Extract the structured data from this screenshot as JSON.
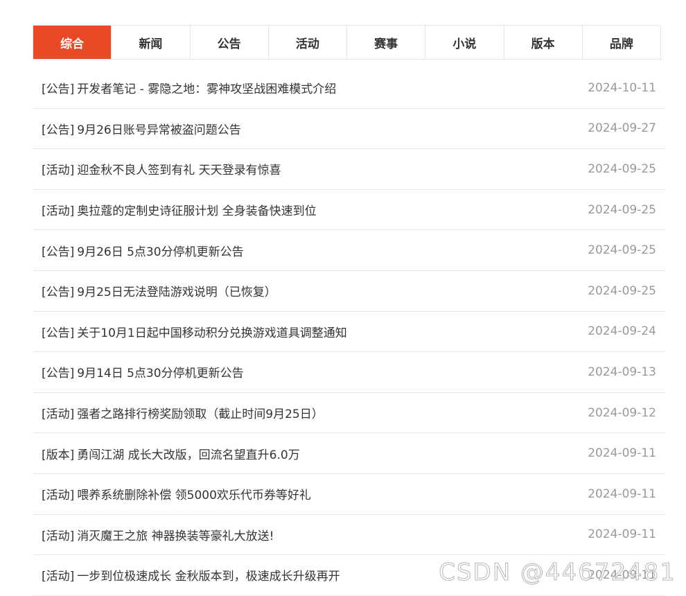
{
  "tabs": [
    {
      "label": "综合",
      "active": true
    },
    {
      "label": "新闻",
      "active": false
    },
    {
      "label": "公告",
      "active": false
    },
    {
      "label": "活动",
      "active": false
    },
    {
      "label": "赛事",
      "active": false
    },
    {
      "label": "小说",
      "active": false
    },
    {
      "label": "版本",
      "active": false
    },
    {
      "label": "品牌",
      "active": false
    }
  ],
  "news": [
    {
      "category": "[公告]",
      "title": "开发者笔记 - 雾隐之地：雾神攻坚战困难模式介绍",
      "date": "2024-10-11"
    },
    {
      "category": "[公告]",
      "title": "9月26日账号异常被盗问题公告",
      "date": "2024-09-27"
    },
    {
      "category": "[活动]",
      "title": "迎金秋不良人签到有礼 天天登录有惊喜",
      "date": "2024-09-25"
    },
    {
      "category": "[活动]",
      "title": "奥拉蔻的定制史诗征服计划 全身装备快速到位",
      "date": "2024-09-25"
    },
    {
      "category": "[公告]",
      "title": "9月26日 5点30分停机更新公告",
      "date": "2024-09-25"
    },
    {
      "category": "[公告]",
      "title": "9月25日无法登陆游戏说明（已恢复）",
      "date": "2024-09-25"
    },
    {
      "category": "[公告]",
      "title": "关于10月1日起中国移动积分兑换游戏道具调整通知",
      "date": "2024-09-24"
    },
    {
      "category": "[公告]",
      "title": "9月14日 5点30分停机更新公告",
      "date": "2024-09-13"
    },
    {
      "category": "[活动]",
      "title": "强者之路排行榜奖励领取（截止时间9月25日）",
      "date": "2024-09-12"
    },
    {
      "category": "[版本]",
      "title": "勇闯江湖 成长大改版，回流名望直升6.0万",
      "date": "2024-09-11"
    },
    {
      "category": "[活动]",
      "title": "喂养系统删除补偿 领5000欢乐代币券等好礼",
      "date": "2024-09-11"
    },
    {
      "category": "[活动]",
      "title": "消灭魔王之旅 神器换装等豪礼大放送!",
      "date": "2024-09-11"
    },
    {
      "category": "[活动]",
      "title": "一步到位极速成长 金秋版本到，极速成长升级再开",
      "date": "2024-09-11"
    }
  ],
  "watermark": "CSDN @44672481",
  "colors": {
    "accent": "#e84a26",
    "text": "#333333",
    "date": "#999999",
    "border": "#e8e8e8"
  }
}
